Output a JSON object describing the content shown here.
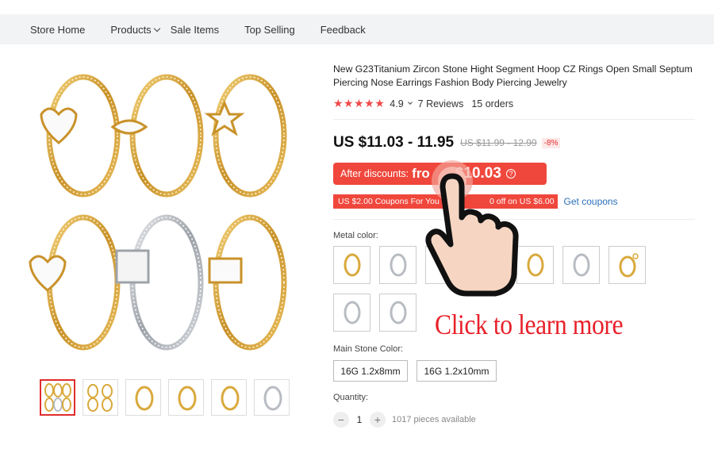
{
  "nav": {
    "items": [
      "Store Home",
      "Products",
      "Sale Items",
      "Top Selling",
      "Feedback"
    ]
  },
  "product": {
    "title": "New G23Titanium Zircon Stone Hight Segment Hoop CZ Rings Open Small Septum Piercing Nose Earrings Fashion Body Piercing Jewelry",
    "rating_value": "4.9",
    "stars": "★★★★★",
    "reviews": "7 Reviews",
    "orders": "15 orders",
    "price": "US $11.03 - 11.95",
    "original_price": "US $11.99 - 12.99",
    "discount": "-8%",
    "after_discounts_label": "After discounts:",
    "after_discounts_from": "fro",
    "after_discounts_price": "$10.03",
    "coupon_1": "US $2.00 Coupons For You",
    "coupon_2": "0 off on US $6.00",
    "get_coupons": "Get coupons"
  },
  "options": {
    "metal_color_label": "Metal color:",
    "main_stone_label": "Main Stone Color:",
    "sizes": [
      "16G 1.2x8mm",
      "16G 1.2x10mm"
    ],
    "quantity_label": "Quantity:",
    "quantity_value": "1",
    "minus": "−",
    "plus": "+",
    "available": "1017 pieces available"
  },
  "overlay": {
    "cta_text": "Click to learn more"
  },
  "colors": {
    "accent_red": "#f0473c",
    "star_red": "#f04a4a",
    "link_blue": "#2a6fb8",
    "gold": "#d9a93c",
    "silver": "#b8bcc2"
  }
}
